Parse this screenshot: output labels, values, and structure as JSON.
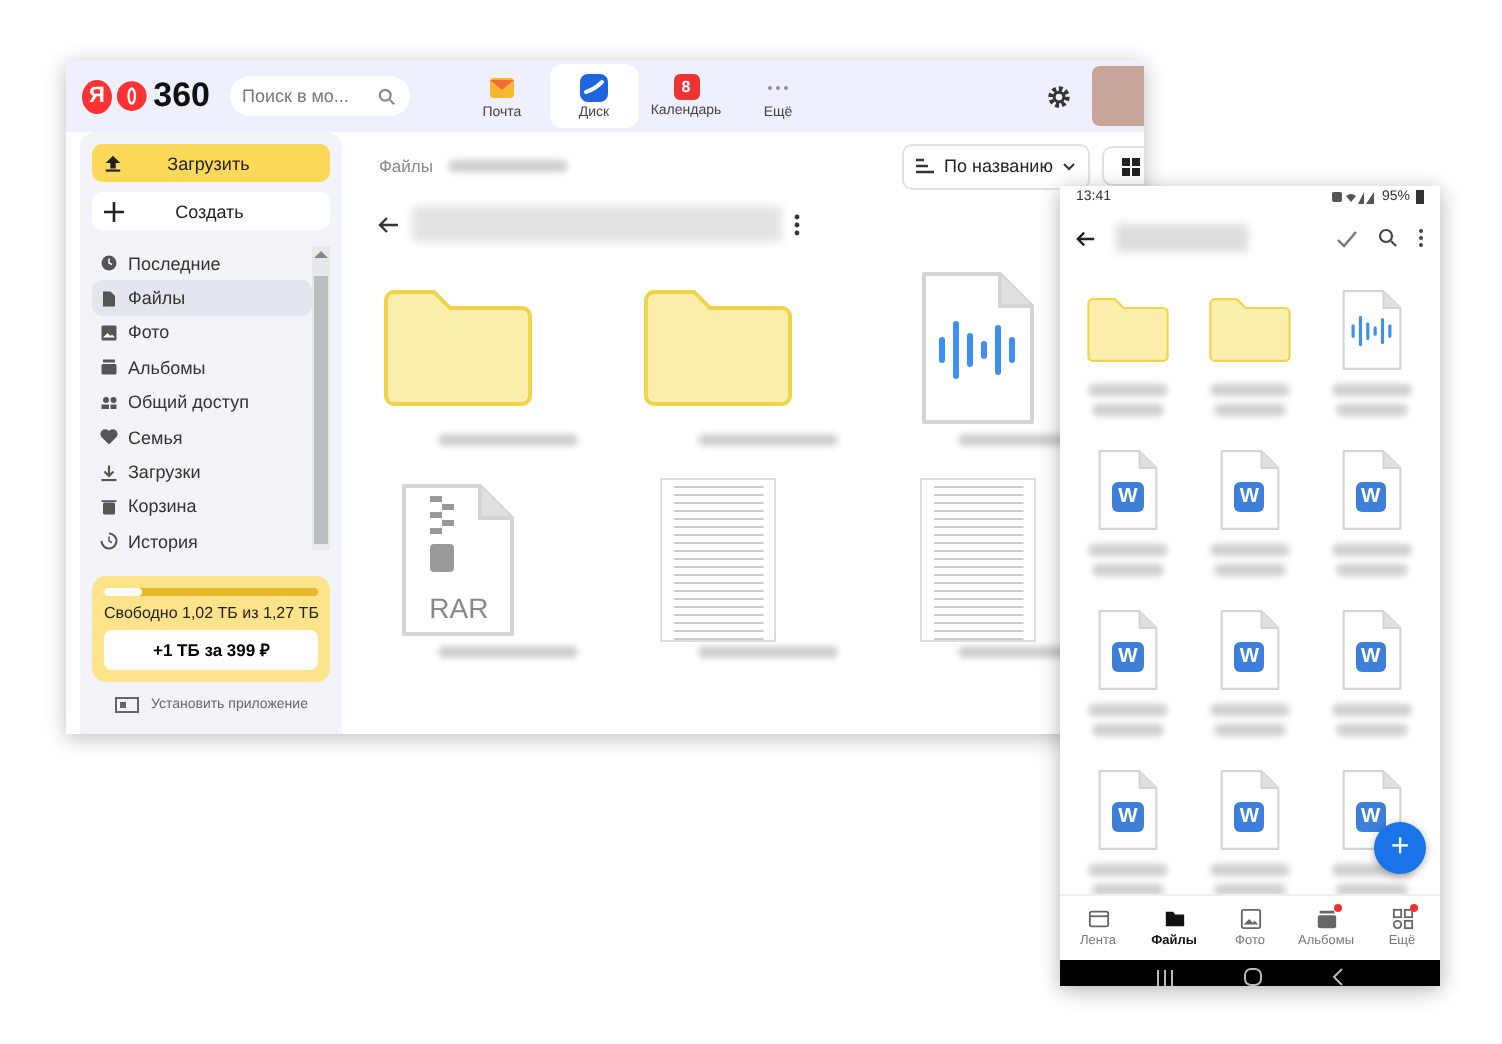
{
  "desktop": {
    "header": {
      "logo_letter": "Я",
      "logo_text": "360",
      "search": {
        "placeholder": "Поиск в мо..."
      },
      "tabs": [
        {
          "label": "Почта",
          "selected": false
        },
        {
          "label": "Диск",
          "selected": true
        },
        {
          "label": "Календарь",
          "selected": false,
          "icon_text": "8"
        },
        {
          "label": "Ещё",
          "selected": false
        }
      ]
    },
    "sidebar": {
      "upload_button": "Загрузить",
      "create_button": "Создать",
      "items": [
        {
          "label": "Последние",
          "selected": false
        },
        {
          "label": "Файлы",
          "selected": true
        },
        {
          "label": "Фото",
          "selected": false
        },
        {
          "label": "Альбомы",
          "selected": false
        },
        {
          "label": "Общий доступ",
          "selected": false
        },
        {
          "label": "Семья",
          "selected": false
        },
        {
          "label": "Загрузки",
          "selected": false
        },
        {
          "label": "Корзина",
          "selected": false
        },
        {
          "label": "История",
          "selected": false
        }
      ],
      "storage": {
        "level": 0.18,
        "text": "Свободно 1,02 ТБ из 1,27 ТБ",
        "button": "+1 ТБ за 399 ₽"
      },
      "install_link": "Установить приложение"
    },
    "main": {
      "breadcrumb": "Файлы",
      "sort_button": "По названию",
      "items": [
        {
          "kind": "folder"
        },
        {
          "kind": "folder"
        },
        {
          "kind": "audio"
        },
        {
          "kind": "rar",
          "label": "RAR"
        },
        {
          "kind": "document"
        },
        {
          "kind": "document"
        }
      ]
    }
  },
  "phone": {
    "status": {
      "time": "13:41",
      "battery": "95%"
    },
    "items": [
      {
        "kind": "folder"
      },
      {
        "kind": "folder"
      },
      {
        "kind": "audio"
      },
      {
        "kind": "word",
        "letter": "W"
      },
      {
        "kind": "word",
        "letter": "W"
      },
      {
        "kind": "word",
        "letter": "W"
      },
      {
        "kind": "word",
        "letter": "W"
      },
      {
        "kind": "word",
        "letter": "W"
      },
      {
        "kind": "word",
        "letter": "W"
      },
      {
        "kind": "word",
        "letter": "W"
      },
      {
        "kind": "word",
        "letter": "W"
      },
      {
        "kind": "word",
        "letter": "W"
      }
    ],
    "fab": "+",
    "bottom_nav": [
      {
        "label": "Лента",
        "selected": false,
        "badge": false
      },
      {
        "label": "Файлы",
        "selected": true,
        "badge": false
      },
      {
        "label": "Фото",
        "selected": false,
        "badge": false
      },
      {
        "label": "Альбомы",
        "selected": false,
        "badge": true
      },
      {
        "label": "Ещё",
        "selected": false,
        "badge": true
      }
    ]
  }
}
